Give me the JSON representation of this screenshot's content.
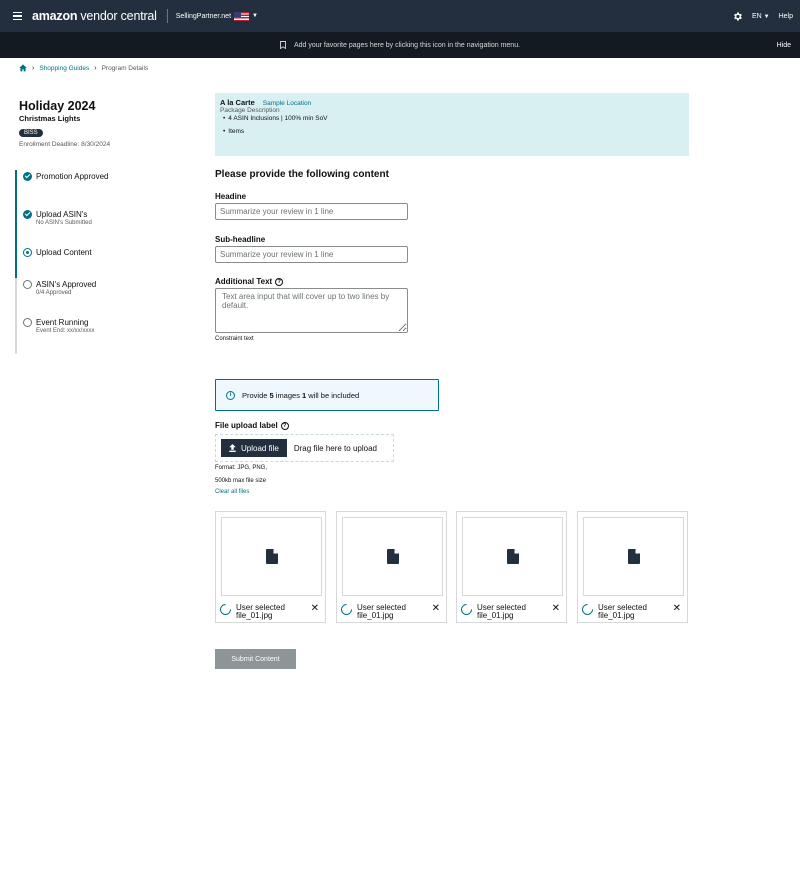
{
  "topbar": {
    "logo_bold": "amazon",
    "logo_rest": "vendor central",
    "marketplace": "SellingPartner.net",
    "language": "EN",
    "help": "Help"
  },
  "favbar": {
    "message": "Add your favorite pages here by clicking this icon in the navigation menu.",
    "hide": "Hide"
  },
  "breadcrumb": {
    "items": [
      "Shopping Guides",
      "Program Details"
    ]
  },
  "program": {
    "title": "Holiday 2024",
    "subtitle": "Christmas Lights",
    "badge": "BISS",
    "deadline": "Enrollment Deadline: 8/30/2024"
  },
  "steps": [
    {
      "label": "Promotion Approved",
      "sub": "",
      "state": "done"
    },
    {
      "label": "Upload ASIN's",
      "sub": "No ASIN's Submitted",
      "state": "done"
    },
    {
      "label": "Upload Content",
      "sub": "",
      "state": "current"
    },
    {
      "label": "ASIN's Approved",
      "sub": "0/4 Approved",
      "state": "todo"
    },
    {
      "label": "Event Running",
      "sub": "Event End: xx/xx/xxxx",
      "state": "todo"
    }
  ],
  "package": {
    "name": "A la Carte",
    "location": "Sample Location",
    "description": "Package Description",
    "bullets": [
      "4 ASIN Inclusions | 100% min SoV",
      "Items"
    ]
  },
  "form": {
    "section_title": "Please provide the following content",
    "headline_label": "Headine",
    "headline_placeholder": "Summarize your review in 1 line",
    "subheadline_label": "Sub-headline",
    "subheadline_placeholder": "Summarize your review in 1 line",
    "additional_label": "Additional Text",
    "additional_placeholder": "Text area input that will cover up to two lines by default.",
    "constraint": "Constraint text"
  },
  "alert": {
    "pre": "Provide ",
    "count": "5",
    "mid": " images ",
    "included": "1",
    "post": " will be included"
  },
  "upload": {
    "label": "File upload label",
    "button": "Upload file",
    "drag_text": "Drag file here to upload",
    "format": "Format: JPG, PNG,",
    "size": "500kb max file size",
    "clear": "Clear all files"
  },
  "files": [
    {
      "name": "User selected file_01.jpg"
    },
    {
      "name": "User selected file_01.jpg"
    },
    {
      "name": "User selected file_01.jpg"
    },
    {
      "name": "User selected file_01.jpg"
    }
  ],
  "submit": "Submit Content",
  "colors": {
    "topbar": "#232f3e",
    "favbar": "#131a22",
    "accent": "#007185",
    "package_bg": "#d8f0f1",
    "submit_disabled": "#8d9599"
  },
  "icons": [
    "menu-icon",
    "gear-icon",
    "bookmark-icon",
    "home-icon",
    "check-circle-icon",
    "radio-icon",
    "help-icon",
    "info-icon",
    "upload-icon",
    "file-icon",
    "spinner-icon",
    "close-icon"
  ]
}
